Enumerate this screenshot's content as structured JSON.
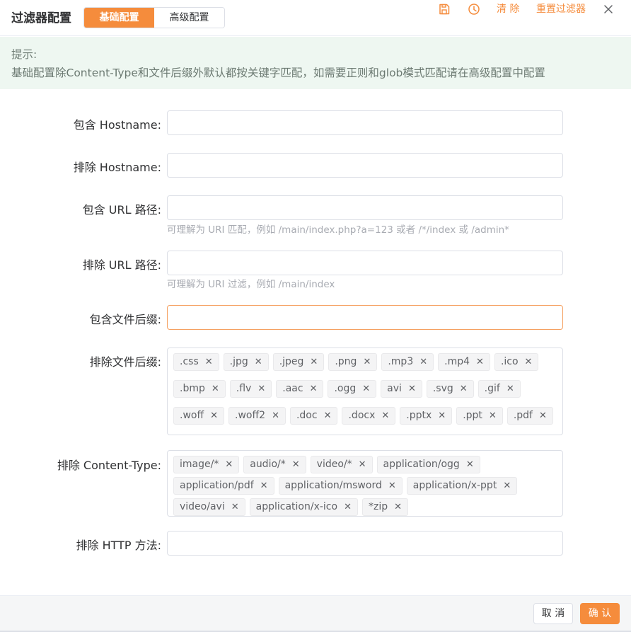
{
  "header": {
    "title": "过滤器配置",
    "tabs": [
      {
        "label": "基础配置",
        "active": true
      },
      {
        "label": "高级配置",
        "active": false
      }
    ],
    "actions": {
      "save_icon": "save-icon",
      "history_icon": "clock-icon",
      "clear_label": "清 除",
      "reset_label": "重置过滤器",
      "close_icon": "close-icon"
    }
  },
  "tip": {
    "title": "提示:",
    "text": "基础配置除Content-Type和文件后缀外默认都按关键字匹配，如需要正则和glob模式匹配请在高级配置中配置"
  },
  "form": {
    "include_hostname": {
      "label": "包含 Hostname:",
      "value": ""
    },
    "exclude_hostname": {
      "label": "排除 Hostname:",
      "value": ""
    },
    "include_url": {
      "label": "包含 URL 路径:",
      "value": "",
      "hint": "可理解为 URI 匹配，例如 /main/index.php?a=123 或者 /*/index 或 /admin*"
    },
    "exclude_url": {
      "label": "排除 URL 路径:",
      "value": "",
      "hint": "可理解为 URI 过滤，例如 /main/index"
    },
    "include_suffix": {
      "label": "包含文件后缀:",
      "value": ""
    },
    "exclude_suffix": {
      "label": "排除文件后缀:",
      "tags": [
        ".css",
        ".jpg",
        ".jpeg",
        ".png",
        ".mp3",
        ".mp4",
        ".ico",
        ".bmp",
        ".flv",
        ".aac",
        ".ogg",
        "avi",
        ".svg",
        ".gif",
        ".woff",
        ".woff2",
        ".doc",
        ".docx",
        ".pptx",
        ".ppt",
        ".pdf"
      ]
    },
    "exclude_content_type": {
      "label": "排除 Content-Type:",
      "tags": [
        "image/*",
        "audio/*",
        "video/*",
        "application/ogg",
        "application/pdf",
        "application/msword",
        "application/x-ppt",
        "video/avi",
        "application/x-ico",
        "*zip"
      ]
    },
    "exclude_http_method": {
      "label": "排除 HTTP 方法:",
      "value": ""
    }
  },
  "footer": {
    "cancel_label": "取 消",
    "ok_label": "确 认"
  },
  "colors": {
    "accent": "#f58c3c",
    "tip_bg": "#eef7f1"
  }
}
